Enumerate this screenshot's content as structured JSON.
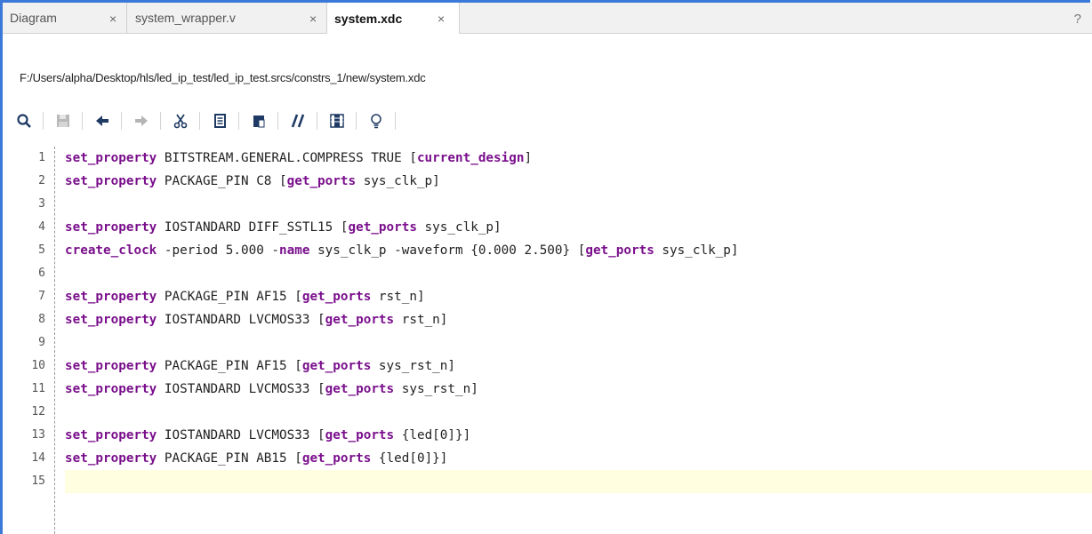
{
  "tabs": [
    {
      "label": "Diagram",
      "close": "×"
    },
    {
      "label": "system_wrapper.v",
      "close": "×"
    },
    {
      "label": "system.xdc",
      "close": "×",
      "active": true
    }
  ],
  "help_label": "?",
  "file_path": "F:/Users/alpha/Desktop/hls/led_ip_test/led_ip_test.srcs/constrs_1/new/system.xdc",
  "toolbar": {
    "icons": [
      "search-icon",
      "save-icon",
      "undo-icon",
      "redo-icon",
      "cut-icon",
      "copy-icon",
      "paste-icon",
      "comment-toggle-icon",
      "column-select-icon",
      "lightbulb-icon"
    ]
  },
  "colors": {
    "accent": "#3b78d8",
    "keyword": "#7a0f8c",
    "current_line": "#fffee0"
  },
  "code": {
    "lines": [
      {
        "num": "1",
        "parts": [
          {
            "t": "set_property",
            "k": true
          },
          {
            "t": " BITSTREAM.GENERAL.COMPRESS TRUE ["
          },
          {
            "t": "current_design",
            "k": true
          },
          {
            "t": "]"
          }
        ]
      },
      {
        "num": "2",
        "parts": [
          {
            "t": "set_property",
            "k": true
          },
          {
            "t": " PACKAGE_PIN C8 ["
          },
          {
            "t": "get_ports",
            "k": true
          },
          {
            "t": " sys_clk_p]"
          }
        ]
      },
      {
        "num": "3",
        "parts": []
      },
      {
        "num": "4",
        "parts": [
          {
            "t": "set_property",
            "k": true
          },
          {
            "t": " IOSTANDARD DIFF_SSTL15 ["
          },
          {
            "t": "get_ports",
            "k": true
          },
          {
            "t": " sys_clk_p]"
          }
        ]
      },
      {
        "num": "5",
        "parts": [
          {
            "t": "create_clock",
            "k": true
          },
          {
            "t": " -period 5.000 -"
          },
          {
            "t": "name",
            "k": true
          },
          {
            "t": " sys_clk_p -waveform {0.000 2.500} ["
          },
          {
            "t": "get_ports",
            "k": true
          },
          {
            "t": " sys_clk_p]"
          }
        ]
      },
      {
        "num": "6",
        "parts": []
      },
      {
        "num": "7",
        "parts": [
          {
            "t": "set_property",
            "k": true
          },
          {
            "t": " PACKAGE_PIN AF15 ["
          },
          {
            "t": "get_ports",
            "k": true
          },
          {
            "t": " rst_n]"
          }
        ]
      },
      {
        "num": "8",
        "parts": [
          {
            "t": "set_property",
            "k": true
          },
          {
            "t": " IOSTANDARD LVCMOS33 ["
          },
          {
            "t": "get_ports",
            "k": true
          },
          {
            "t": " rst_n]"
          }
        ]
      },
      {
        "num": "9",
        "parts": []
      },
      {
        "num": "10",
        "parts": [
          {
            "t": "set_property",
            "k": true
          },
          {
            "t": " PACKAGE_PIN AF15 ["
          },
          {
            "t": "get_ports",
            "k": true
          },
          {
            "t": " sys_rst_n]"
          }
        ]
      },
      {
        "num": "11",
        "parts": [
          {
            "t": "set_property",
            "k": true
          },
          {
            "t": " IOSTANDARD LVCMOS33 ["
          },
          {
            "t": "get_ports",
            "k": true
          },
          {
            "t": " sys_rst_n]"
          }
        ]
      },
      {
        "num": "12",
        "parts": []
      },
      {
        "num": "13",
        "parts": [
          {
            "t": "set_property",
            "k": true
          },
          {
            "t": " IOSTANDARD LVCMOS33 ["
          },
          {
            "t": "get_ports",
            "k": true
          },
          {
            "t": " {led[0]}]"
          }
        ]
      },
      {
        "num": "14",
        "parts": [
          {
            "t": "set_property",
            "k": true
          },
          {
            "t": " PACKAGE_PIN AB15 ["
          },
          {
            "t": "get_ports",
            "k": true
          },
          {
            "t": " {led[0]}]"
          }
        ]
      },
      {
        "num": "15",
        "parts": [],
        "current": true
      }
    ]
  }
}
